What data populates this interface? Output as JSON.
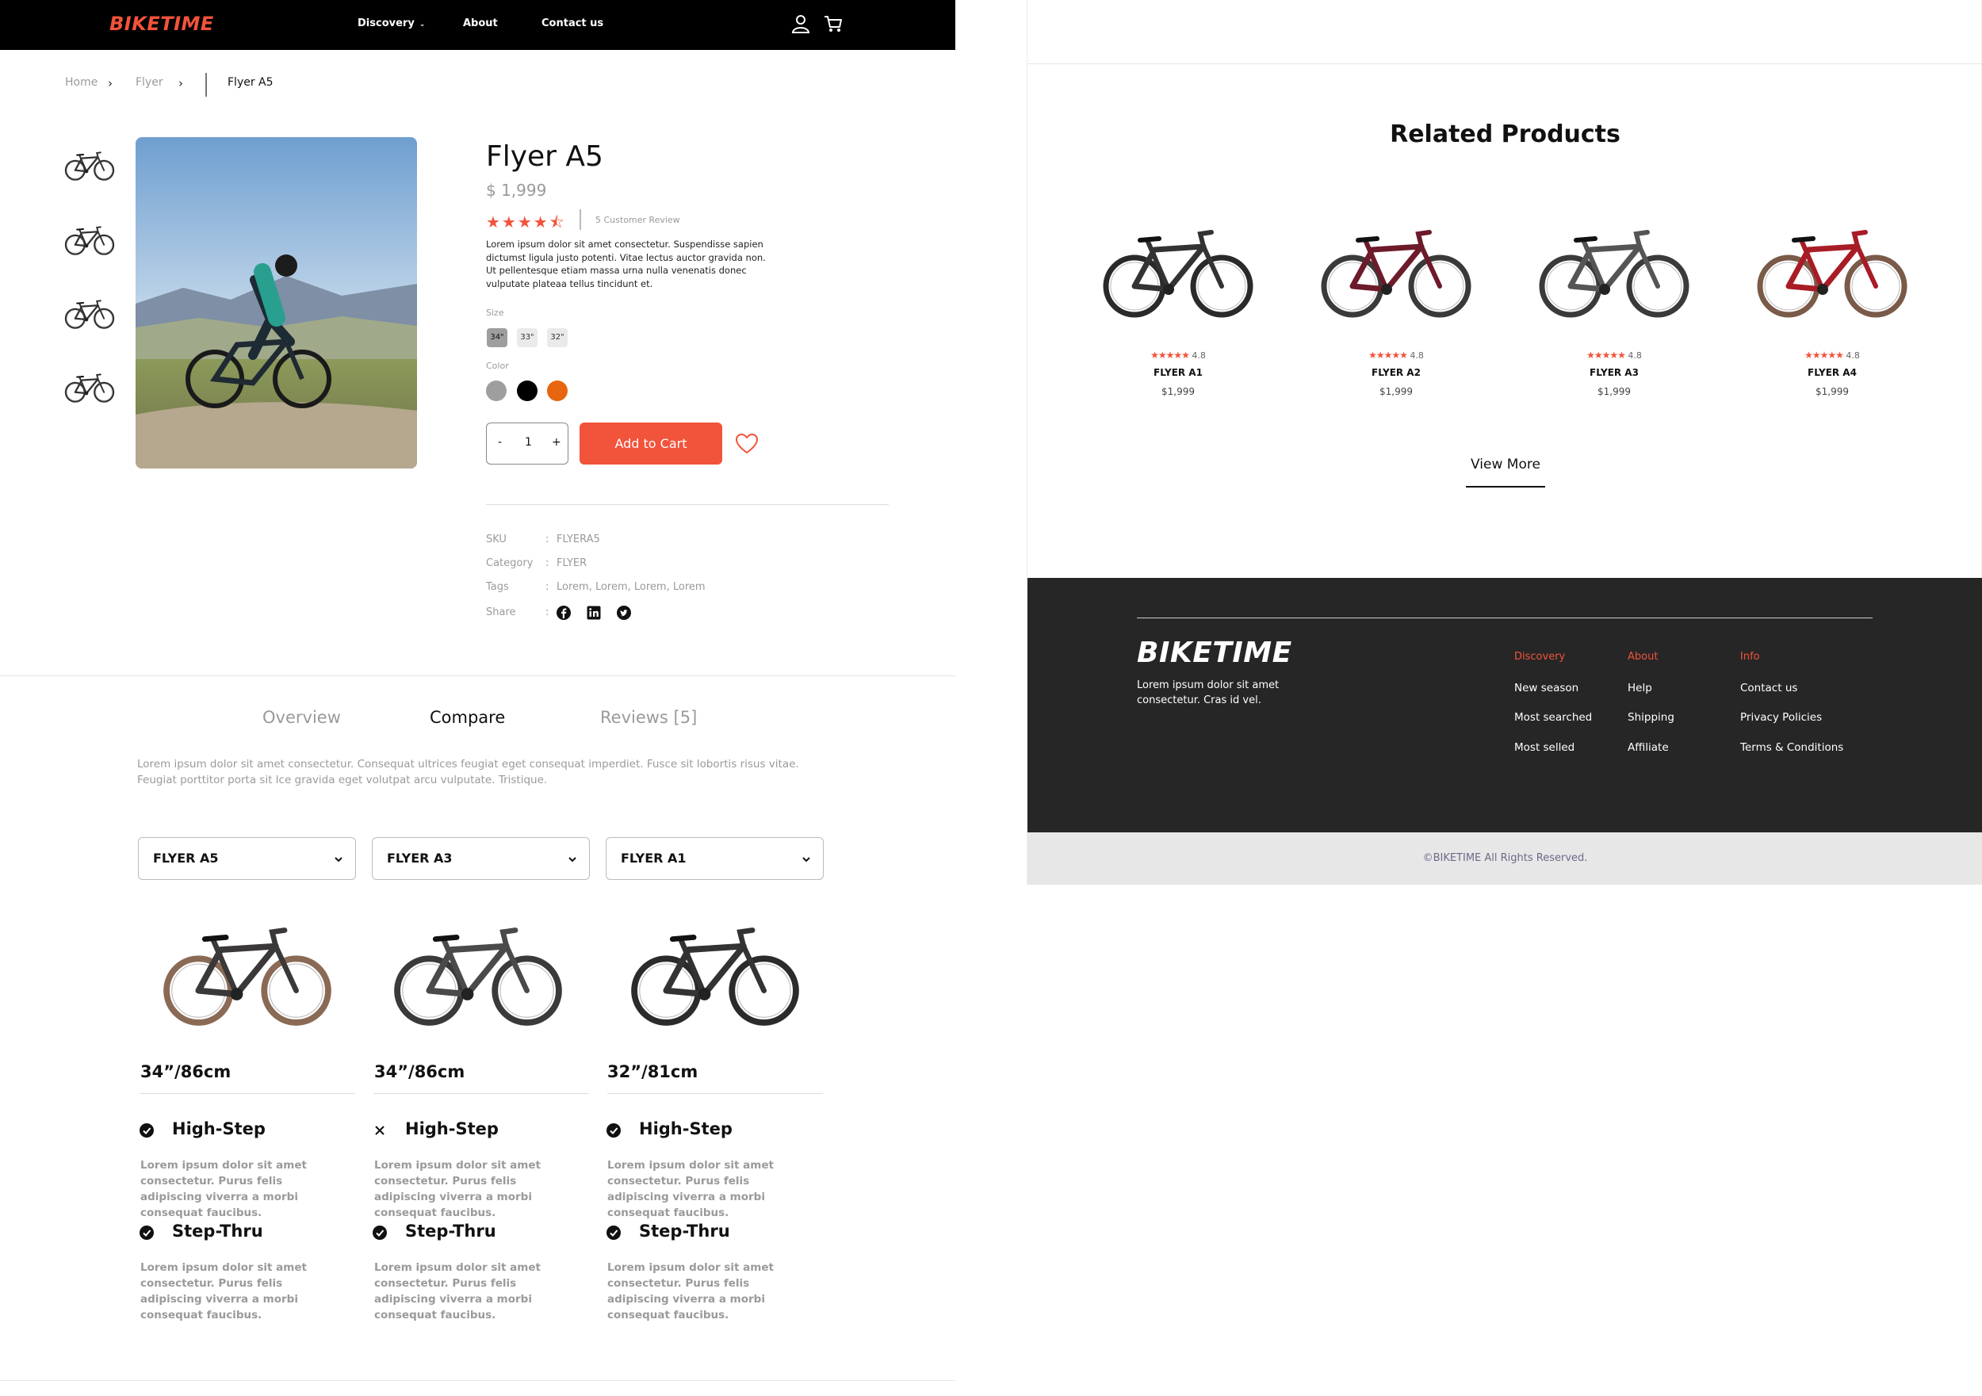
{
  "brand": {
    "name": "BIKETIME",
    "accent": "#f2533b",
    "footer_bg": "#262626"
  },
  "nav": {
    "items": [
      {
        "label": "Discovery",
        "has_dropdown": true
      },
      {
        "label": "About"
      },
      {
        "label": "Contact us"
      }
    ],
    "icons": [
      "user-icon",
      "cart-icon"
    ]
  },
  "breadcrumb": {
    "items": [
      "Home",
      "Flyer"
    ],
    "current": "Flyer A5"
  },
  "product": {
    "title": "Flyer A5",
    "price": "$ 1,999",
    "rating": 4.5,
    "review_count": "5 Customer Review",
    "description": "Lorem ipsum dolor sit amet consectetur. Suspendisse sapien dictumst ligula justo potenti. Vitae lectus auctor gravida non. Ut pellentesque etiam massa urna nulla venenatis donec vulputate plateaa tellus tincidunt et.",
    "size_label": "Size",
    "sizes": [
      "34\"",
      "33\"",
      "32\""
    ],
    "selected_size": "34\"",
    "color_label": "Color",
    "colors": [
      "#9e9e9e",
      "#000000",
      "#e8650f"
    ],
    "quantity": {
      "minus": "-",
      "value": "1",
      "plus": "+"
    },
    "add_to_cart": "Add to Cart",
    "meta": {
      "sku_label": "SKU",
      "sku": "FLYERA5",
      "category_label": "Category",
      "category": "FLYER",
      "tags_label": "Tags",
      "tags": "Lorem, Lorem, Lorem, Lorem",
      "share_label": "Share",
      "colon": ":"
    },
    "share_icons": [
      "facebook-icon",
      "linkedin-icon",
      "twitter-icon"
    ]
  },
  "tabs": {
    "items": [
      "Overview",
      "Compare",
      "Reviews [5]"
    ],
    "active": "Compare",
    "text": "Lorem ipsum dolor sit amet consectetur. Consequat ultrices feugiat eget consequat imperdiet. Fusce sit lobortis risus vitae. Feugiat porttitor porta sit lce gravida eget volutpat arcu vulputate. Tristique."
  },
  "compare": {
    "columns": [
      {
        "model": "FLYER A5",
        "size": "34”/86cm",
        "features": [
          {
            "title": "High-Step",
            "available": true,
            "text": "Lorem ipsum dolor sit amet consectetur. Purus felis adipiscing viverra a morbi consequat faucibus."
          },
          {
            "title": "Step-Thru",
            "available": true,
            "text": "Lorem ipsum dolor sit amet consectetur. Purus felis adipiscing viverra a morbi consequat faucibus."
          }
        ]
      },
      {
        "model": "FLYER A3",
        "size": "34”/86cm",
        "features": [
          {
            "title": "High-Step",
            "available": false,
            "text": "Lorem ipsum dolor sit amet consectetur. Purus felis adipiscing viverra a morbi consequat faucibus."
          },
          {
            "title": "Step-Thru",
            "available": true,
            "text": "Lorem ipsum dolor sit amet consectetur. Purus felis adipiscing viverra a morbi consequat faucibus."
          }
        ]
      },
      {
        "model": "FLYER A1",
        "size": "32”/81cm",
        "features": [
          {
            "title": "High-Step",
            "available": true,
            "text": "Lorem ipsum dolor sit amet consectetur. Purus felis adipiscing viverra a morbi consequat faucibus."
          },
          {
            "title": "Step-Thru",
            "available": true,
            "text": "Lorem ipsum dolor sit amet consectetur. Purus felis adipiscing viverra a morbi consequat faucibus."
          }
        ]
      }
    ]
  },
  "related": {
    "title": "Related Products",
    "items": [
      {
        "name": "FLYER A1",
        "rating": "4.8",
        "price": "$1,999"
      },
      {
        "name": "FLYER A2",
        "rating": "4.8",
        "price": "$1,999"
      },
      {
        "name": "FLYER A3",
        "rating": "4.8",
        "price": "$1,999"
      },
      {
        "name": "FLYER A4",
        "rating": "4.8",
        "price": "$1,999"
      }
    ],
    "stars": "★★★★★",
    "view_more": "View More"
  },
  "footer": {
    "logo": "BIKETIME",
    "description": "Lorem ipsum dolor sit amet consectetur. Cras id vel.",
    "columns": [
      {
        "heading": "Discovery",
        "links": [
          "New season",
          "Most searched",
          "Most selled"
        ]
      },
      {
        "heading": "About",
        "links": [
          "Help",
          "Shipping",
          "Affiliate"
        ]
      },
      {
        "heading": "Info",
        "links": [
          "Contact us",
          "Privacy Policies",
          "Terms & Conditions"
        ]
      }
    ],
    "copyright": "©BIKETIME All Rights Reserved."
  }
}
